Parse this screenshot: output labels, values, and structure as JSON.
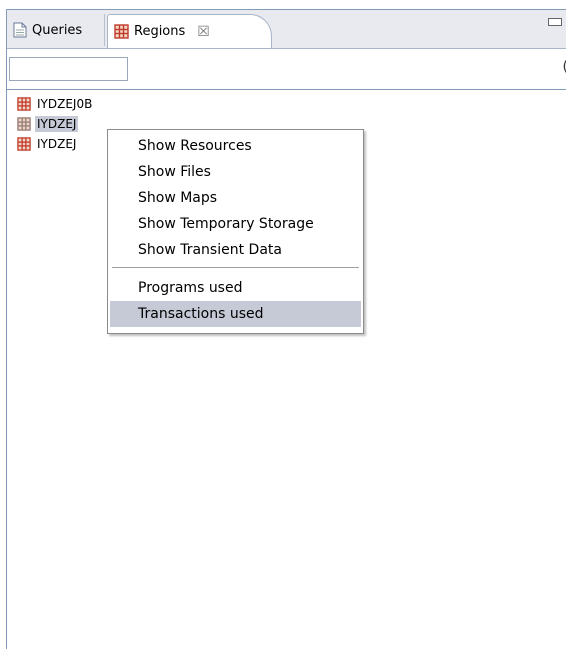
{
  "tabs": [
    {
      "label": "Queries",
      "icon": "document-icon"
    },
    {
      "label": "Regions",
      "icon": "region-grid-icon",
      "close_glyph": "☒"
    }
  ],
  "filter": {
    "value": "",
    "trailing_glyph": "("
  },
  "tree": {
    "items": [
      {
        "label": "IYDZEJ0B",
        "selected": false
      },
      {
        "label": "IYDZEJ",
        "selected": true
      },
      {
        "label": "IYDZEJ",
        "selected": false
      }
    ]
  },
  "context_menu": {
    "group1": [
      "Show Resources",
      "Show Files",
      "Show Maps",
      "Show Temporary Storage",
      "Show Transient Data"
    ],
    "group2": [
      "Programs used",
      "Transactions used"
    ],
    "highlighted": "Transactions used"
  },
  "colors": {
    "region_icon": "#c0392b",
    "selection": "#c6c9d6"
  }
}
